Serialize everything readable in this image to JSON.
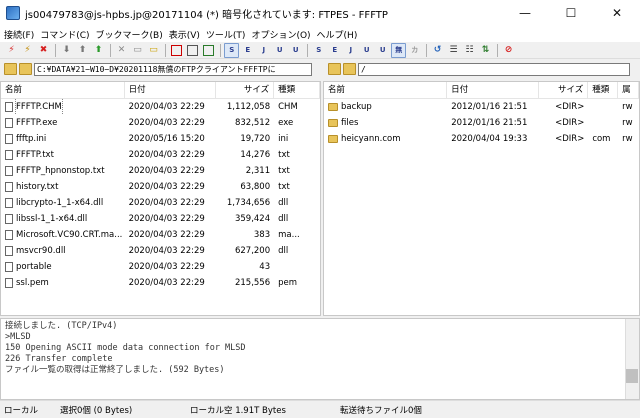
{
  "window": {
    "title": "js00479783@js-hpbs.jp@20171104 (*) 暗号化されています: FTPES - FFFTP",
    "minimize": "—",
    "maximize": "☐",
    "close": "✕"
  },
  "menu": [
    "接続(F)",
    "コマンド(C)",
    "ブックマーク(B)",
    "表示(V)",
    "ツール(T)",
    "オプション(O)",
    "ヘルプ(H)"
  ],
  "toolbar": {
    "labels": [
      "S",
      "E",
      "J",
      "U",
      "U",
      "S",
      "E",
      "J",
      "U",
      "U",
      "無",
      "カ"
    ]
  },
  "local": {
    "path": "C:¥DATA¥21−W10−D¥20201118無償のFTPクライアントFFFTPに",
    "headers": [
      "名前",
      "日付",
      "サイズ",
      "種類"
    ],
    "files": [
      {
        "name": "FFFTP.CHM",
        "date": "2020/04/03 22:29",
        "size": "1,112,058",
        "type": "CHM"
      },
      {
        "name": "FFFTP.exe",
        "date": "2020/04/03 22:29",
        "size": "832,512",
        "type": "exe"
      },
      {
        "name": "ffftp.ini",
        "date": "2020/05/16 15:20",
        "size": "19,720",
        "type": "ini"
      },
      {
        "name": "FFFTP.txt",
        "date": "2020/04/03 22:29",
        "size": "14,276",
        "type": "txt"
      },
      {
        "name": "FFFTP_hpnonstop.txt",
        "date": "2020/04/03 22:29",
        "size": "2,311",
        "type": "txt"
      },
      {
        "name": "history.txt",
        "date": "2020/04/03 22:29",
        "size": "63,800",
        "type": "txt"
      },
      {
        "name": "libcrypto-1_1-x64.dll",
        "date": "2020/04/03 22:29",
        "size": "1,734,656",
        "type": "dll"
      },
      {
        "name": "libssl-1_1-x64.dll",
        "date": "2020/04/03 22:29",
        "size": "359,424",
        "type": "dll"
      },
      {
        "name": "Microsoft.VC90.CRT.ma...",
        "date": "2020/04/03 22:29",
        "size": "383",
        "type": "ma..."
      },
      {
        "name": "msvcr90.dll",
        "date": "2020/04/03 22:29",
        "size": "627,200",
        "type": "dll"
      },
      {
        "name": "portable",
        "date": "2020/04/03 22:29",
        "size": "43",
        "type": ""
      },
      {
        "name": "ssl.pem",
        "date": "2020/04/03 22:29",
        "size": "215,556",
        "type": "pem"
      }
    ]
  },
  "remote": {
    "path": "/",
    "headers": [
      "名前",
      "日付",
      "サイズ",
      "種類",
      "属"
    ],
    "files": [
      {
        "name": "backup",
        "date": "2012/01/16 21:51",
        "size": "<DIR>",
        "type": "",
        "attr": "rw"
      },
      {
        "name": "files",
        "date": "2012/01/16 21:51",
        "size": "<DIR>",
        "type": "",
        "attr": "rw"
      },
      {
        "name": "heicyann.com",
        "date": "2020/04/04 19:33",
        "size": "<DIR>",
        "type": "com",
        "attr": "rw"
      }
    ]
  },
  "log": [
    "接続しました. (TCP/IPv4)",
    ">MLSD",
    "150 Opening ASCII mode data connection for MLSD",
    "226 Transfer complete",
    "ファイル一覧の取得は正常終了しました. (592 Bytes)"
  ],
  "status": {
    "location": "ローカル",
    "selection": "選択0個 (0 Bytes)",
    "free": "ローカル空 1.91T Bytes",
    "pending": "転送待ちファイル0個"
  },
  "colors": {
    "accent_blue": "#1f5fb8",
    "folder": "#e8c45a",
    "stop_red": "#d62020"
  }
}
